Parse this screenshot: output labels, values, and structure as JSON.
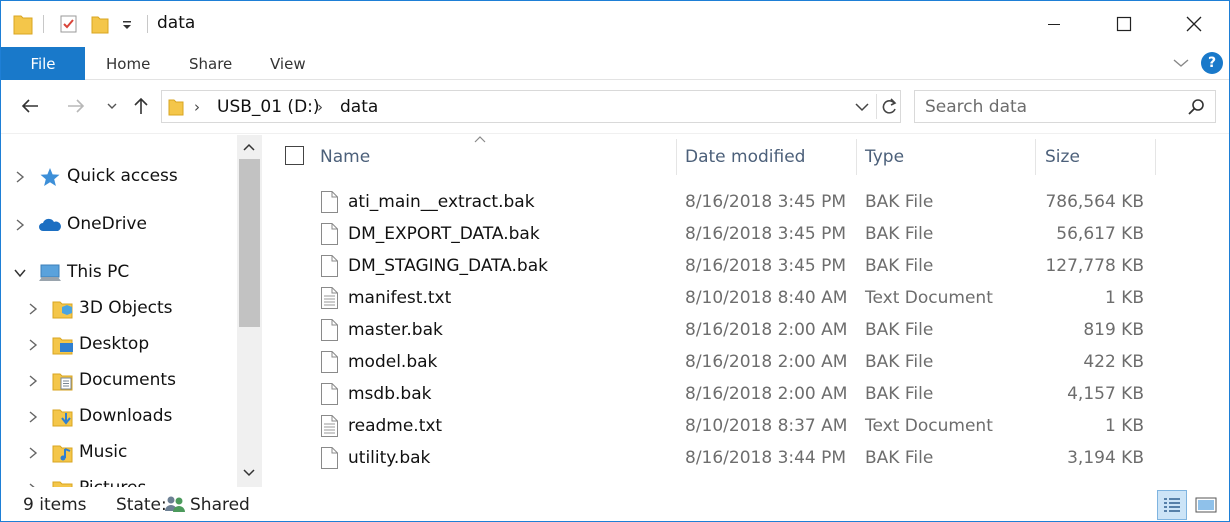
{
  "window": {
    "title": "data",
    "minimize_glyph": "—",
    "maximize_glyph": "☐",
    "close_glyph": "✕"
  },
  "ribbon": {
    "tabs": [
      "File",
      "Home",
      "Share",
      "View"
    ],
    "help_glyph": "?"
  },
  "address": {
    "segments": [
      "USB_01 (D:)",
      "data"
    ]
  },
  "search": {
    "placeholder": "Search data"
  },
  "nav_pane": {
    "items": [
      {
        "label": "Quick access",
        "icon": "star-icon",
        "expanded": false
      },
      {
        "label": "OneDrive",
        "icon": "cloud-icon",
        "expanded": false
      },
      {
        "label": "This PC",
        "icon": "computer-icon",
        "expanded": true
      },
      {
        "label": "3D Objects",
        "icon": "folder-3d-icon",
        "expanded": false
      },
      {
        "label": "Desktop",
        "icon": "desktop-folder-icon",
        "expanded": false
      },
      {
        "label": "Documents",
        "icon": "documents-folder-icon",
        "expanded": false
      },
      {
        "label": "Downloads",
        "icon": "downloads-folder-icon",
        "expanded": false
      },
      {
        "label": "Music",
        "icon": "music-folder-icon",
        "expanded": false
      },
      {
        "label": "Pictures",
        "icon": "pictures-folder-icon",
        "expanded": false
      }
    ]
  },
  "file_list": {
    "columns": {
      "name": "Name",
      "date": "Date modified",
      "type": "Type",
      "size": "Size"
    },
    "rows": [
      {
        "name": "ati_main__extract.bak",
        "date": "8/16/2018 3:45 PM",
        "type": "BAK File",
        "size": "786,564 KB",
        "icon": "blank-file-icon"
      },
      {
        "name": "DM_EXPORT_DATA.bak",
        "date": "8/16/2018 3:45 PM",
        "type": "BAK File",
        "size": "56,617 KB",
        "icon": "blank-file-icon"
      },
      {
        "name": "DM_STAGING_DATA.bak",
        "date": "8/16/2018 3:45 PM",
        "type": "BAK File",
        "size": "127,778 KB",
        "icon": "blank-file-icon"
      },
      {
        "name": "manifest.txt",
        "date": "8/10/2018 8:40 AM",
        "type": "Text Document",
        "size": "1 KB",
        "icon": "text-file-icon"
      },
      {
        "name": "master.bak",
        "date": "8/16/2018 2:00 AM",
        "type": "BAK File",
        "size": "819 KB",
        "icon": "blank-file-icon"
      },
      {
        "name": "model.bak",
        "date": "8/16/2018 2:00 AM",
        "type": "BAK File",
        "size": "422 KB",
        "icon": "blank-file-icon"
      },
      {
        "name": "msdb.bak",
        "date": "8/16/2018 2:00 AM",
        "type": "BAK File",
        "size": "4,157 KB",
        "icon": "blank-file-icon"
      },
      {
        "name": "readme.txt",
        "date": "8/10/2018 8:37 AM",
        "type": "Text Document",
        "size": "1 KB",
        "icon": "text-file-icon"
      },
      {
        "name": "utility.bak",
        "date": "8/16/2018 3:44 PM",
        "type": "BAK File",
        "size": "3,194 KB",
        "icon": "blank-file-icon"
      }
    ]
  },
  "status": {
    "item_count": "9 items",
    "state_label": "State:",
    "state_value": "Shared"
  },
  "colors": {
    "accent": "#1979ca",
    "header_text": "#4c607a",
    "muted_text": "#6d6d6d",
    "folder_yellow": "#f4c64a"
  }
}
